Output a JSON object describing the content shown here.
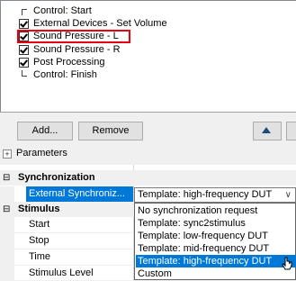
{
  "steps": [
    {
      "label": "Control: Start",
      "type": "bracket-start"
    },
    {
      "label": "External Devices - Set Volume",
      "type": "checkbox",
      "checked": true
    },
    {
      "label": "Sound Pressure - L",
      "type": "checkbox",
      "checked": true,
      "selected": true
    },
    {
      "label": "Sound Pressure - R",
      "type": "checkbox",
      "checked": true
    },
    {
      "label": "Post Processing",
      "type": "checkbox",
      "checked": true
    },
    {
      "label": "Control: Finish",
      "type": "bracket-end"
    }
  ],
  "buttons": {
    "add": "Add...",
    "remove": "Remove",
    "move_up_icon": "arrow-up-icon"
  },
  "parameters": {
    "title": "Parameters",
    "expander": "+",
    "collapse_glyph": "⊟",
    "rows": [
      {
        "kind": "category",
        "label": "Synchronization"
      },
      {
        "kind": "property",
        "name": "External Synchroniz...",
        "value": "Template: high-frequency DUT",
        "selected": true
      },
      {
        "kind": "category",
        "label": "Stimulus"
      },
      {
        "kind": "property",
        "name": "Start"
      },
      {
        "kind": "property",
        "name": "Stop"
      },
      {
        "kind": "property",
        "name": "Time"
      },
      {
        "kind": "property",
        "name": "Stimulus Level"
      }
    ]
  },
  "dropdown": {
    "selected": "Template: high-frequency DUT",
    "options": [
      "No synchronization request",
      "Template: sync2stimulus",
      "Template: low-frequency DUT",
      "Template: mid-frequency DUT",
      "Template: high-frequency DUT",
      "Custom"
    ],
    "highlighted_index": 4
  }
}
